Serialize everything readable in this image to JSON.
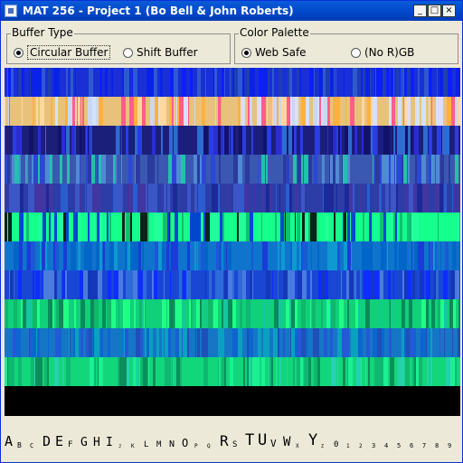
{
  "window": {
    "title": "MAT 256 - Project 1 (Bo Bell & John Roberts)",
    "controls": {
      "minimize": "_",
      "maximize": "□",
      "close": "×"
    }
  },
  "buffer_type": {
    "title": "Buffer Type",
    "options": [
      {
        "label": "Circular Buffer",
        "selected": true
      },
      {
        "label": "Shift Buffer",
        "selected": false
      }
    ]
  },
  "color_palette": {
    "title": "Color Palette",
    "options": [
      {
        "label": "Web Safe",
        "selected": true
      },
      {
        "label": "(No R)GB",
        "selected": false
      }
    ]
  },
  "visualization": {
    "bands": [
      {
        "base": "#1a2fd6",
        "alt": [
          "#0a22e8",
          "#2e5ad0",
          "#1f3fae",
          "#0c1fff"
        ]
      },
      {
        "base": "#e8c27a",
        "alt": [
          "#ff5d8a",
          "#ffd7a0",
          "#c9d8f0",
          "#ffb040",
          "#d6e0ff"
        ]
      },
      {
        "base": "#1b1f7a",
        "alt": [
          "#2a3ee0",
          "#12126b",
          "#2f6bd0",
          "#2b2bd8"
        ]
      },
      {
        "base": "#3a58b0",
        "alt": [
          "#4f8ad4",
          "#2a3a9f",
          "#24c0ad",
          "#2b47d6"
        ]
      },
      {
        "base": "#2c3da8",
        "alt": [
          "#3c56c6",
          "#1b2a98",
          "#2a5dd0",
          "#4236a0"
        ]
      },
      {
        "base": "#14ff8c",
        "alt": [
          "#0a2418",
          "#0fc070",
          "#0047d0",
          "#22ff9a"
        ]
      },
      {
        "base": "#0f74cc",
        "alt": [
          "#0066c8",
          "#1b3bd8",
          "#0e9ad0",
          "#1a58d6"
        ]
      },
      {
        "base": "#1a46d4",
        "alt": [
          "#2d6bd8",
          "#1538b8",
          "#4a7be0",
          "#0e2dff"
        ]
      },
      {
        "base": "#10d07a",
        "alt": [
          "#1fff85",
          "#0a8a5a",
          "#16c6a0",
          "#0fb86a"
        ]
      },
      {
        "base": "#1576c6",
        "alt": [
          "#0d65d0",
          "#1f4fb8",
          "#0aa0c0",
          "#2458d6"
        ]
      },
      {
        "base": "#12d67a",
        "alt": [
          "#1af092",
          "#0b8f5a",
          "#26d0b0",
          "#0fb870"
        ]
      },
      {
        "base": "#000000",
        "alt": [
          "#000000"
        ]
      }
    ]
  },
  "alphabet": {
    "glyphs": [
      {
        "ch": "A",
        "size": 15
      },
      {
        "ch": "B",
        "size": 8
      },
      {
        "ch": "C",
        "size": 7
      },
      {
        "ch": "D",
        "size": 15
      },
      {
        "ch": "E",
        "size": 15
      },
      {
        "ch": "F",
        "size": 9
      },
      {
        "ch": "G",
        "size": 13
      },
      {
        "ch": "H",
        "size": 13
      },
      {
        "ch": "I",
        "size": 13
      },
      {
        "ch": "J",
        "size": 5
      },
      {
        "ch": "K",
        "size": 6
      },
      {
        "ch": "L",
        "size": 9
      },
      {
        "ch": "M",
        "size": 9
      },
      {
        "ch": "N",
        "size": 10
      },
      {
        "ch": "O",
        "size": 12
      },
      {
        "ch": "P",
        "size": 6
      },
      {
        "ch": "Q",
        "size": 6
      },
      {
        "ch": "R",
        "size": 16
      },
      {
        "ch": "S",
        "size": 9
      },
      {
        "ch": "T",
        "size": 17
      },
      {
        "ch": "U",
        "size": 17
      },
      {
        "ch": "V",
        "size": 11
      },
      {
        "ch": "W",
        "size": 14
      },
      {
        "ch": "X",
        "size": 6
      },
      {
        "ch": "Y",
        "size": 17
      },
      {
        "ch": "Z",
        "size": 5
      },
      {
        "ch": "0",
        "size": 9
      },
      {
        "ch": "1",
        "size": 6
      },
      {
        "ch": "2",
        "size": 6
      },
      {
        "ch": "3",
        "size": 7
      },
      {
        "ch": "4",
        "size": 7
      },
      {
        "ch": "5",
        "size": 7
      },
      {
        "ch": "6",
        "size": 7
      },
      {
        "ch": "7",
        "size": 7
      },
      {
        "ch": "8",
        "size": 7
      },
      {
        "ch": "9",
        "size": 7
      }
    ]
  }
}
